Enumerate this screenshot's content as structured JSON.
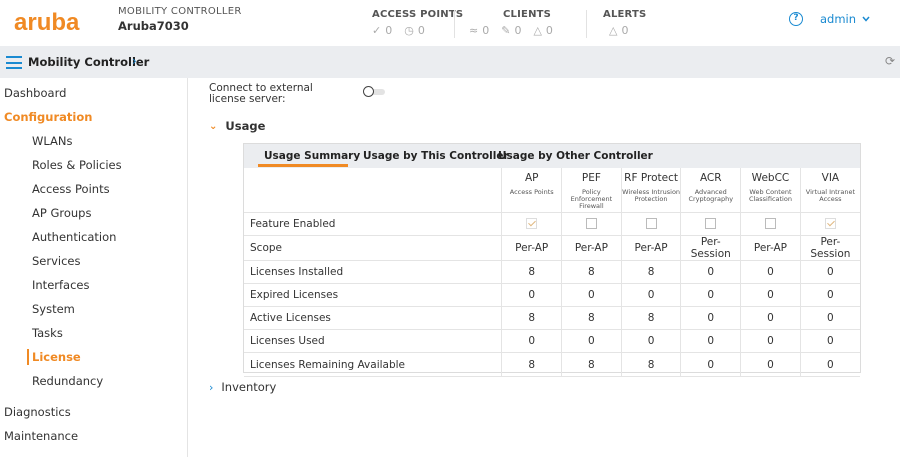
{
  "header": {
    "logo_text": "aruba",
    "controller_label": "MOBILITY CONTROLLER",
    "controller_name": "Aruba7030",
    "access_points": {
      "title": "ACCESS POINTS",
      "up": "0",
      "down": "0"
    },
    "clients": {
      "title": "CLIENTS",
      "wireless": "0",
      "remote": "0",
      "wired": "0"
    },
    "alerts": {
      "title": "ALERTS",
      "count": "0"
    },
    "help_icon": "question-icon",
    "user": "admin"
  },
  "breadcrumb": {
    "label": "Mobility Controller"
  },
  "sidebar": {
    "items": [
      {
        "label": "Dashboard"
      },
      {
        "label": "Configuration"
      },
      {
        "label": "WLANs"
      },
      {
        "label": "Roles & Policies"
      },
      {
        "label": "Access Points"
      },
      {
        "label": "AP Groups"
      },
      {
        "label": "Authentication"
      },
      {
        "label": "Services"
      },
      {
        "label": "Interfaces"
      },
      {
        "label": "System"
      },
      {
        "label": "Tasks"
      },
      {
        "label": "License"
      },
      {
        "label": "Redundancy"
      },
      {
        "label": "Diagnostics"
      },
      {
        "label": "Maintenance"
      }
    ]
  },
  "main": {
    "external_license_label": "Connect to external license server:",
    "usage_title": "Usage",
    "inventory_title": "Inventory",
    "tabs": [
      {
        "label": "Usage Summary"
      },
      {
        "label": "Usage by This Controller"
      },
      {
        "label": "Usage by Other Controller"
      }
    ],
    "columns": [
      {
        "name": "AP",
        "desc": "Access Points"
      },
      {
        "name": "PEF",
        "desc": "Policy Enforcement Firewall"
      },
      {
        "name": "RF Protect",
        "desc": "Wireless Intrusion Protection"
      },
      {
        "name": "ACR",
        "desc": "Advanced Cryptography"
      },
      {
        "name": "WebCC",
        "desc": "Web Content Classification"
      },
      {
        "name": "VIA",
        "desc": "Virtual Intranet Access"
      }
    ],
    "rows": [
      {
        "label": "Feature Enabled",
        "checked": [
          true,
          false,
          false,
          false,
          false,
          true
        ]
      },
      {
        "label": "Scope",
        "values": [
          "Per-AP",
          "Per-AP",
          "Per-AP",
          "Per-Session",
          "Per-AP",
          "Per-Session"
        ]
      },
      {
        "label": "Licenses Installed",
        "values": [
          "8",
          "8",
          "8",
          "0",
          "0",
          "0"
        ]
      },
      {
        "label": "Expired Licenses",
        "values": [
          "0",
          "0",
          "0",
          "0",
          "0",
          "0"
        ]
      },
      {
        "label": "Active Licenses",
        "values": [
          "8",
          "8",
          "8",
          "0",
          "0",
          "0"
        ]
      },
      {
        "label": "Licenses Used",
        "values": [
          "0",
          "0",
          "0",
          "0",
          "0",
          "0"
        ]
      },
      {
        "label": "Licenses Remaining Available",
        "values": [
          "8",
          "8",
          "8",
          "0",
          "0",
          "0"
        ]
      }
    ]
  },
  "colors": {
    "accent": "#f08a24",
    "link": "#1a8ad1"
  }
}
